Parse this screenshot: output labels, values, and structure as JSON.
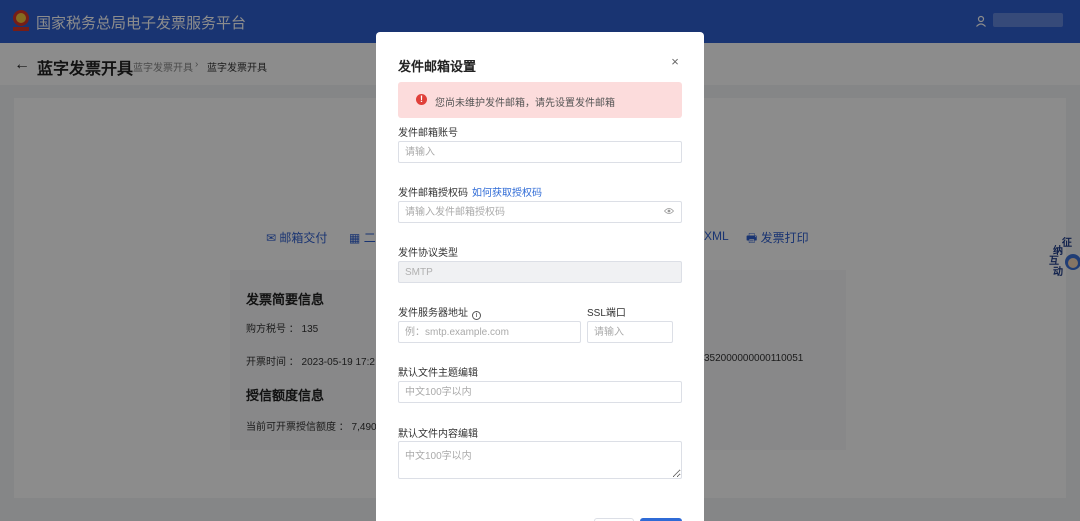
{
  "topbar": {
    "site_title": "国家税务总局电子发票服务平台",
    "user_name": ""
  },
  "subheader": {
    "back_icon": "arrow-left-icon",
    "page_title": "蓝字发票开具",
    "breadcrumb": [
      "蓝字发票开具",
      "›",
      "蓝字发票开具"
    ]
  },
  "actions": [
    {
      "icon": "envelope-icon",
      "label": "邮箱交付"
    },
    {
      "icon": "qrcode-icon",
      "label": "二"
    },
    {
      "icon": "",
      "label": "XML"
    },
    {
      "icon": "printer-icon",
      "label": "发票打印"
    }
  ],
  "summary": {
    "invoice_heading": "发票简要信息",
    "buyer_tax_no": "购方税号 ： 135",
    "issue_time": "开票时间 ： 2023-05-19 17:2",
    "invoice_no": "352000000000110051",
    "credit_heading": "授信额度信息",
    "credit_amount": "当前可开票授信额度 ： 7,490,"
  },
  "side_float": {
    "chars": [
      "征",
      "纳",
      "互",
      "动"
    ]
  },
  "modal": {
    "title": "发件邮箱设置",
    "close_label": "×",
    "alert_text": "您尚未维护发件邮箱，请先设置发件邮箱",
    "fields": {
      "account": {
        "label": "发件邮箱账号",
        "placeholder": "请输入"
      },
      "auth_code": {
        "label": "发件邮箱授权码",
        "help_link": "如何获取授权码",
        "placeholder": "请输入发件邮箱授权码"
      },
      "protocol": {
        "label": "发件协议类型",
        "value": "SMTP"
      },
      "server": {
        "label": "发件服务器地址",
        "placeholder": "例：smtp.example.com"
      },
      "ssl_port": {
        "label": "SSL端口",
        "placeholder": "请输入"
      },
      "subject": {
        "label": "默认文件主题编辑",
        "placeholder": "中文100字以内"
      },
      "body": {
        "label": "默认文件内容编辑",
        "placeholder": "中文100字以内"
      }
    }
  },
  "colors": {
    "brand_blue": "#2f5fd0",
    "link_blue": "#2f6bd6",
    "alert_bg": "#fcdcdc",
    "alert_icon": "#e0403a"
  }
}
